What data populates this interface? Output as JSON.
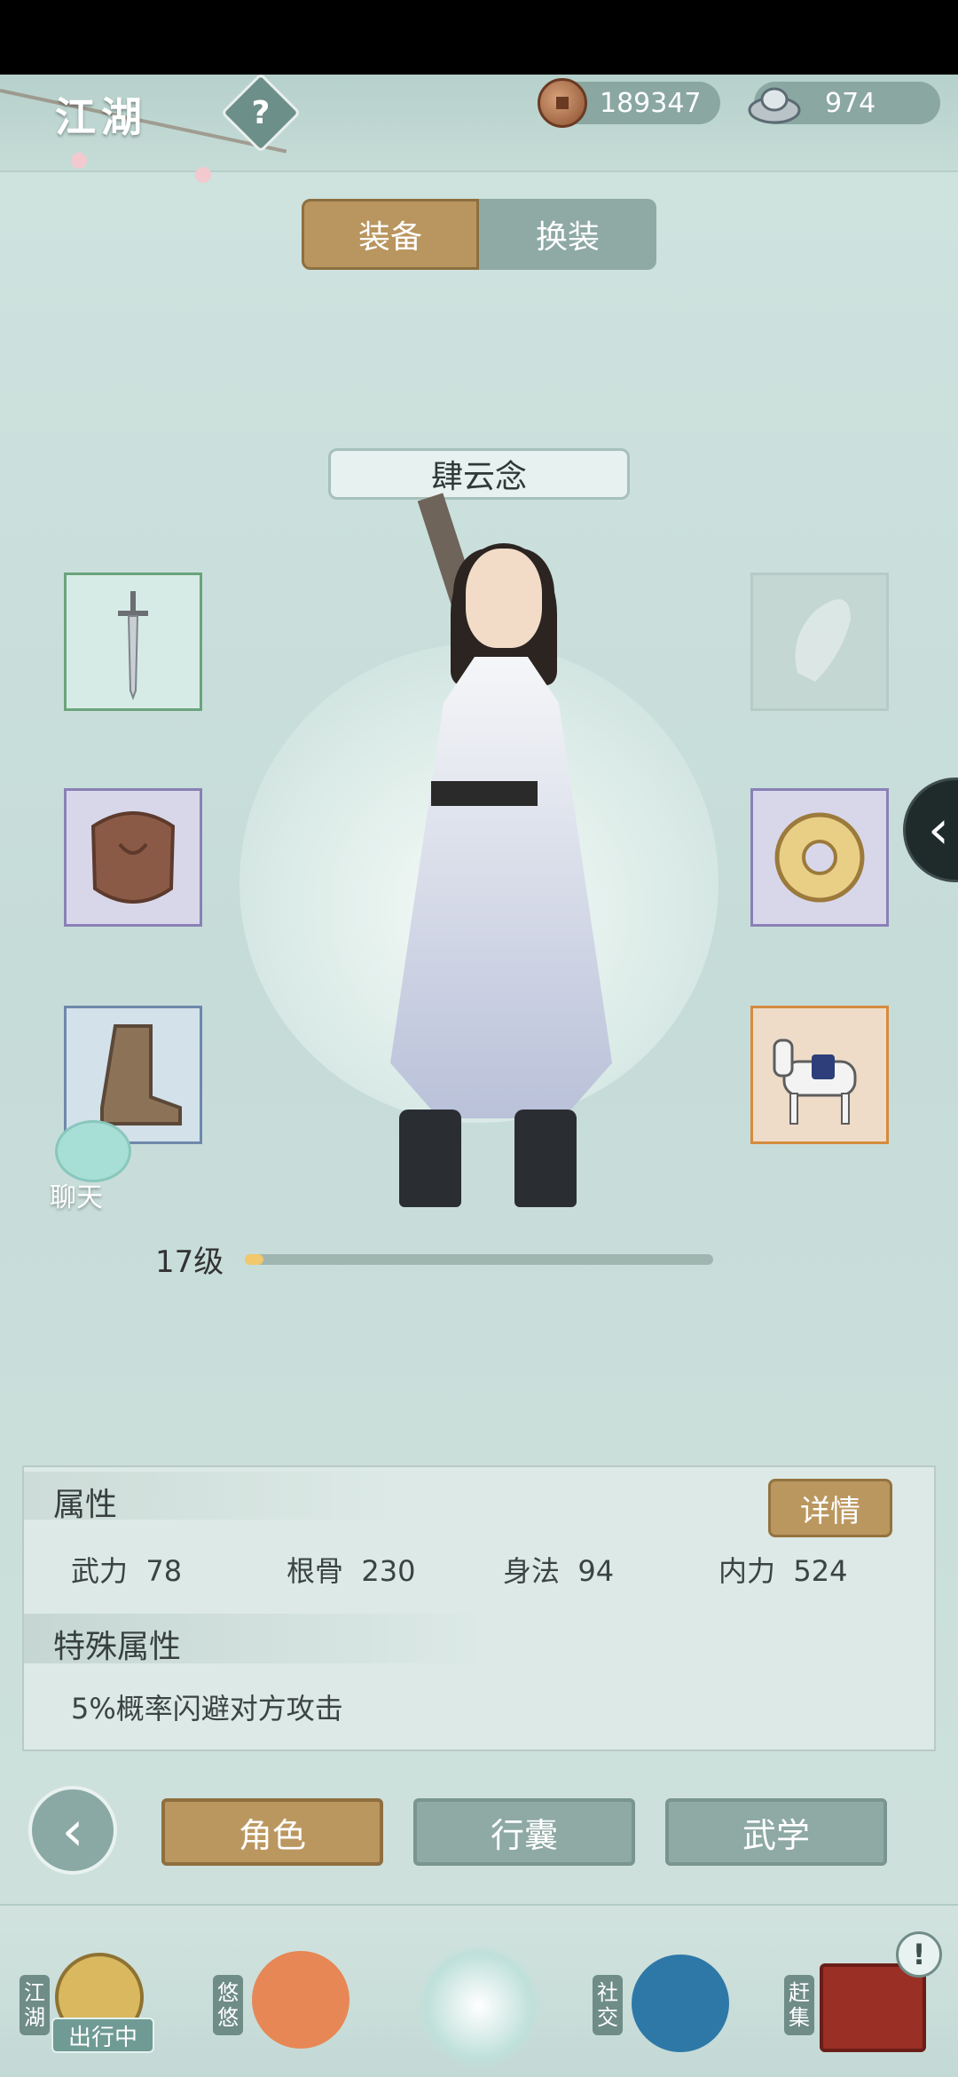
{
  "header": {
    "title": "江湖",
    "help_icon": "question-icon"
  },
  "currencies": {
    "copper": "189347",
    "silver": "974"
  },
  "mode_tabs": {
    "equip": "装备",
    "outfit": "换装"
  },
  "character": {
    "name": "肆云念",
    "level_text": "17级",
    "level_progress": 0.04
  },
  "equipment": {
    "left": [
      {
        "name": "weapon-sword",
        "icon": "sword-icon"
      },
      {
        "name": "armor",
        "icon": "armor-icon"
      },
      {
        "name": "boots",
        "icon": "boots-icon"
      }
    ],
    "right": [
      {
        "name": "bracer-empty",
        "icon": "bracer-icon"
      },
      {
        "name": "jade-accessory",
        "icon": "jade-icon"
      },
      {
        "name": "horse-mount",
        "icon": "horse-icon"
      }
    ]
  },
  "chat": {
    "label": "聊天"
  },
  "attributes": {
    "title": "属性",
    "detail_button": "详情",
    "stats": [
      {
        "label": "武力",
        "value": "78"
      },
      {
        "label": "根骨",
        "value": "230"
      },
      {
        "label": "身法",
        "value": "94"
      },
      {
        "label": "内力",
        "value": "524"
      }
    ],
    "special_title": "特殊属性",
    "special_text": "5%概率闪避对方攻击"
  },
  "bottom_tabs": {
    "role": "角色",
    "bag": "行囊",
    "martial": "武学"
  },
  "dock": {
    "jianghu": "江湖",
    "youyou": "悠悠",
    "social": "社交",
    "market": "赶集",
    "status": "出行中"
  },
  "colors": {
    "gold": "#bb9760",
    "teal": "#8fa9a4",
    "bg": "#cfe2de"
  }
}
